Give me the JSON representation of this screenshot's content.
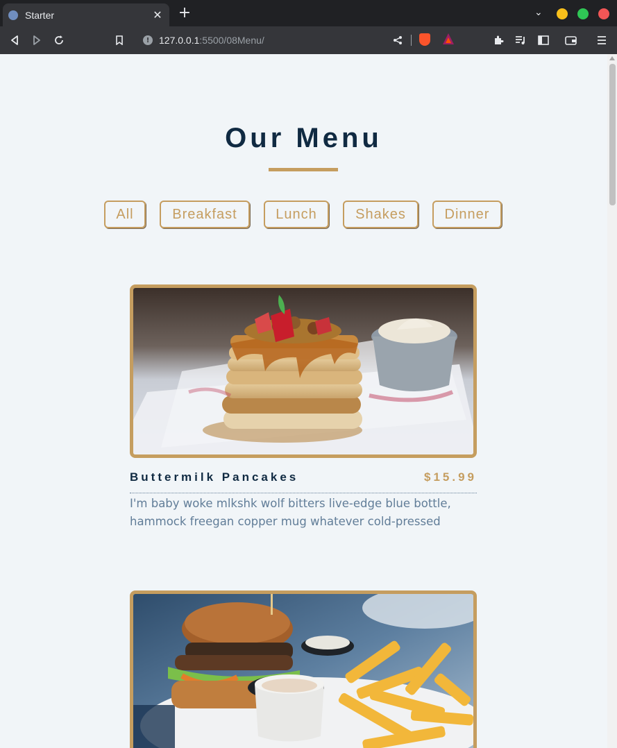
{
  "browser": {
    "tab_title": "Starter",
    "url_host": "127.0.0.1",
    "url_path": ":5500/08Menu/"
  },
  "page": {
    "title": "Our Menu",
    "filters": [
      "All",
      "Breakfast",
      "Lunch",
      "Shakes",
      "Dinner"
    ],
    "items": [
      {
        "name": "Buttermilk Pancakes",
        "price": "$15.99",
        "desc": "I'm baby woke mlkshk wolf bitters live-edge blue bottle, hammock freegan copper mug whatever cold-pressed"
      }
    ]
  },
  "colors": {
    "accent": "#c59d5f",
    "heading": "#102a42",
    "body_text": "#617d98",
    "background": "#f1f5f8"
  }
}
